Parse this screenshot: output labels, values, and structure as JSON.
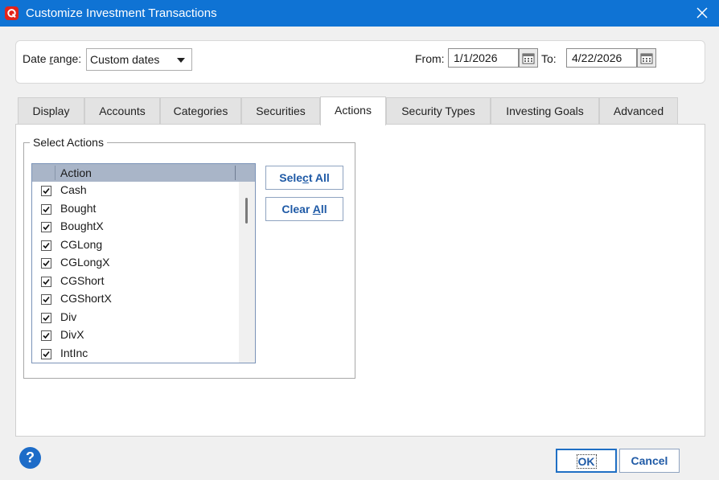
{
  "window": {
    "title": "Customize Investment Transactions"
  },
  "daterange": {
    "label_pre": "Date ",
    "label_u": "r",
    "label_post": "ange:",
    "selected": "Custom dates",
    "from_label": "From:",
    "from_value": "1/1/2026",
    "to_label": "To:",
    "to_value": "4/22/2026"
  },
  "tabs": [
    {
      "label": "Display",
      "active": false
    },
    {
      "label": "Accounts",
      "active": false
    },
    {
      "label": "Categories",
      "active": false
    },
    {
      "label": "Securities",
      "active": false
    },
    {
      "label": "Actions",
      "active": true
    },
    {
      "label": "Security Types",
      "active": false
    },
    {
      "label": "Investing Goals",
      "active": false
    },
    {
      "label": "Advanced",
      "active": false
    }
  ],
  "actions_panel": {
    "group_title": "Select Actions",
    "column_header": "Action",
    "items": [
      {
        "label": "Cash",
        "checked": true
      },
      {
        "label": "Bought",
        "checked": true
      },
      {
        "label": "BoughtX",
        "checked": true
      },
      {
        "label": "CGLong",
        "checked": true
      },
      {
        "label": "CGLongX",
        "checked": true
      },
      {
        "label": "CGShort",
        "checked": true
      },
      {
        "label": "CGShortX",
        "checked": true
      },
      {
        "label": "Div",
        "checked": true
      },
      {
        "label": "DivX",
        "checked": true
      },
      {
        "label": "IntInc",
        "checked": true
      }
    ],
    "select_all": {
      "pre": "Sele",
      "u": "c",
      "post": "t All"
    },
    "clear_all": {
      "pre": "Clear ",
      "u": "A",
      "post": "ll"
    }
  },
  "footer": {
    "help_glyph": "?",
    "help_icon": "help-icon",
    "ok_label": "OK",
    "cancel_label": "Cancel"
  },
  "colors": {
    "titlebar": "#0f73d4",
    "logo": "#e2231a",
    "accent_text": "#1f5aa6"
  }
}
